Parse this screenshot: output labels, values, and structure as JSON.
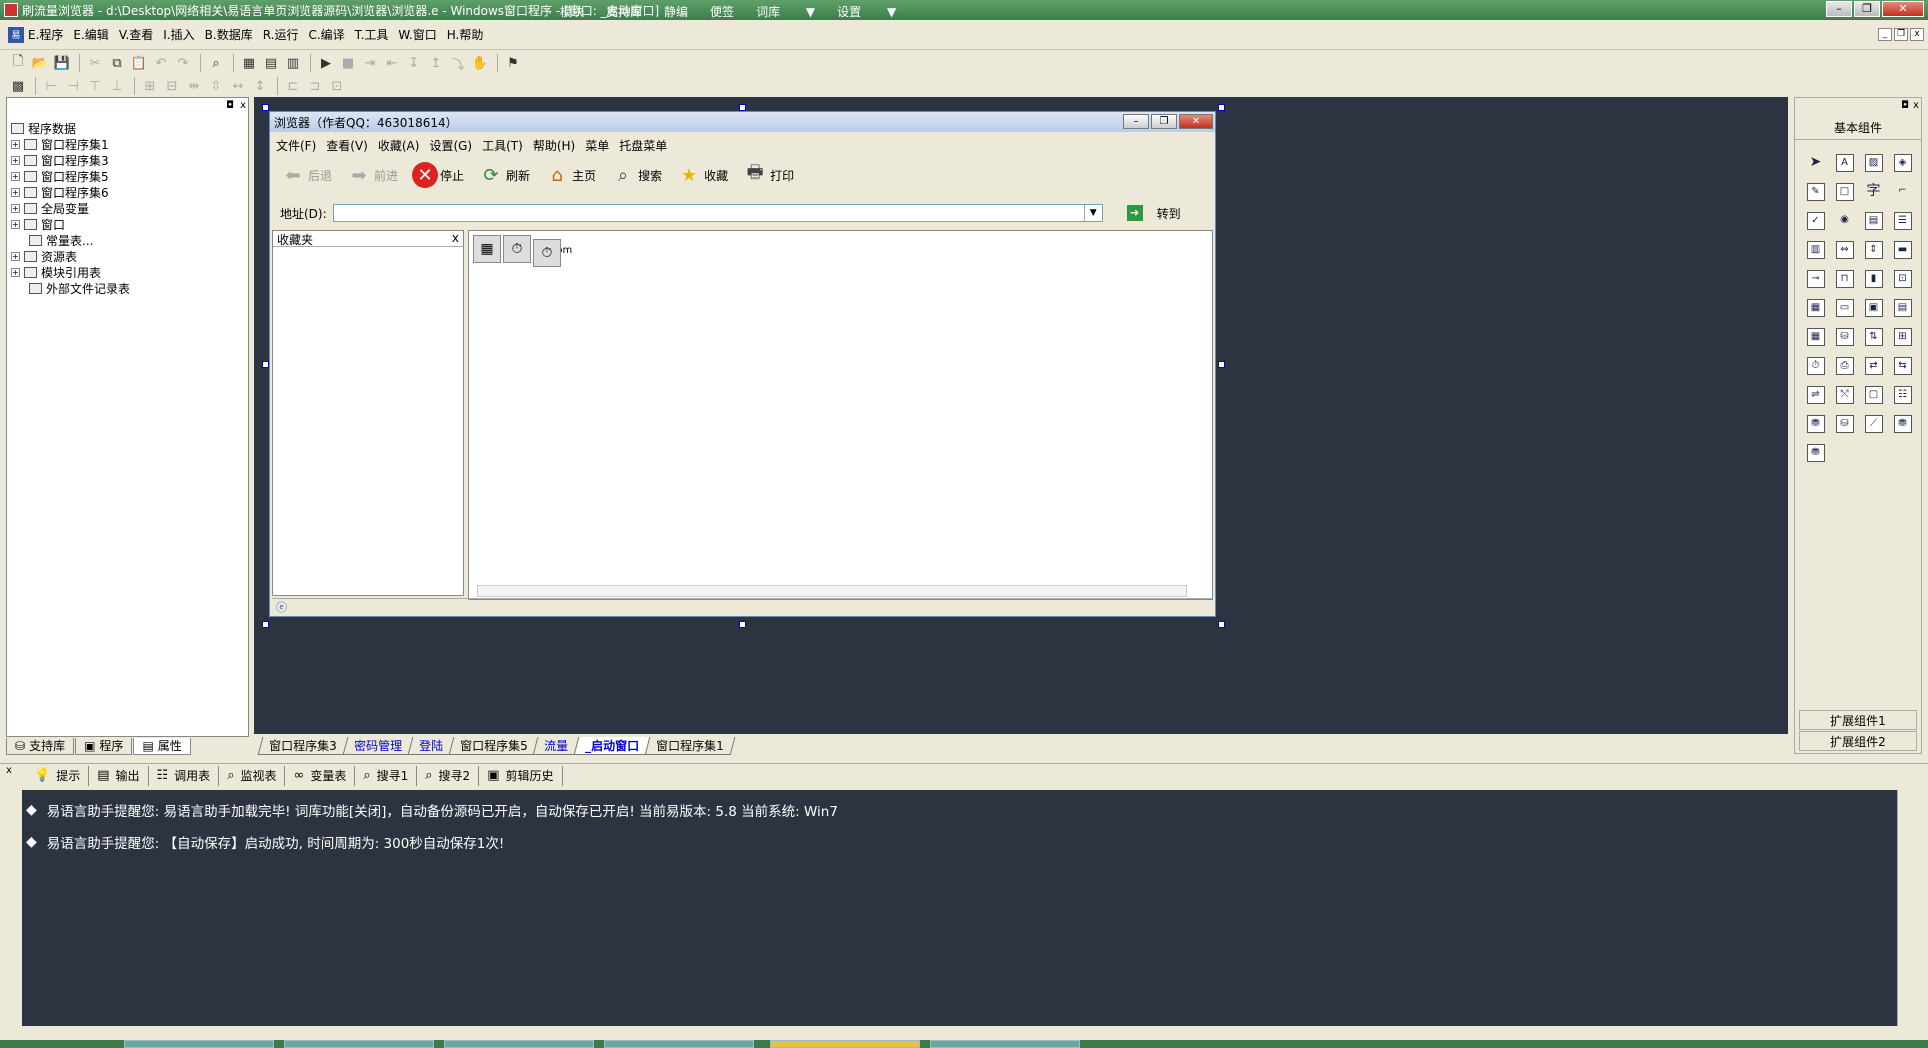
{
  "window": {
    "title": "刷流量浏览器 - d:\\Desktop\\网络相关\\易语言单页浏览器源码\\浏览器\\浏览器.e - Windows窗口程序 - [窗口: _启动窗口]",
    "top_menu": [
      "模块",
      "支持库",
      "静编",
      "便签",
      "词库",
      "设置"
    ]
  },
  "menubar": [
    "E.程序",
    "E.编辑",
    "V.查看",
    "I.插入",
    "B.数据库",
    "R.运行",
    "C.编译",
    "T.工具",
    "W.窗口",
    "H.帮助"
  ],
  "tree": {
    "root": "程序数据",
    "items": [
      "窗口程序集1",
      "窗口程序集3",
      "窗口程序集5",
      "窗口程序集6",
      "全局变量",
      "窗口",
      "常量表...",
      "资源表",
      "模块引用表",
      "外部文件记录表"
    ]
  },
  "left_tabs": [
    "支持库",
    "程序",
    "属性"
  ],
  "design": {
    "title": "浏览器（作者QQ：463018614）",
    "menu": [
      "文件(F)",
      "查看(V)",
      "收藏(A)",
      "设置(G)",
      "工具(T)",
      "帮助(H)",
      "菜单",
      "托盘菜单"
    ],
    "tools": [
      "后退",
      "前进",
      "停止",
      "刷新",
      "主页",
      "搜索",
      "收藏",
      "打印"
    ],
    "address_label": "地址(D):",
    "go_label": "转到",
    "favorites_title": "收藏夹",
    "favorites_close": "x",
    "browse_text": "b...com"
  },
  "doc_tabs": [
    "窗口程序集3",
    "密码管理",
    "登陆",
    "窗口程序集5",
    "流量",
    "_启动窗口",
    "窗口程序集1"
  ],
  "right_panel": {
    "title": "基本组件",
    "ext1": "扩展组件1",
    "ext2": "扩展组件2"
  },
  "bottom_tabs": [
    "提示",
    "输出",
    "调用表",
    "监视表",
    "变量表",
    "搜寻1",
    "搜寻2",
    "剪辑历史"
  ],
  "output": [
    "易语言助手提醒您:  易语言助手加载完毕! 词库功能[关闭]，自动备份源码已开启，自动保存已开启! 当前易版本: 5.8  当前系统: Win7",
    "易语言助手提醒您: 【自动保存】启动成功, 时间周期为: 300秒自动保存1次!"
  ],
  "colors": {
    "workarea": "#2d3441",
    "titlebar": "#3d7d4c"
  }
}
